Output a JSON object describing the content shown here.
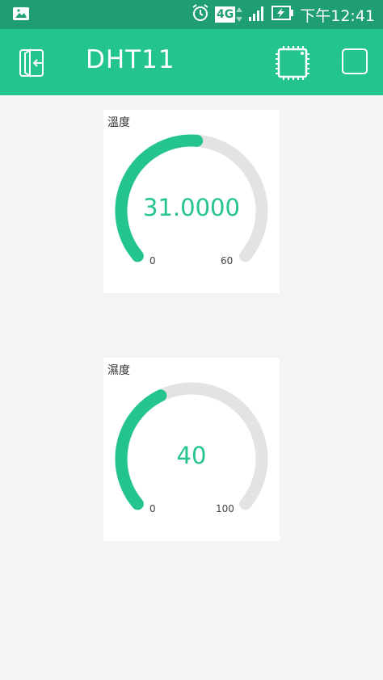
{
  "status": {
    "time": "下午12:41",
    "network": "4G"
  },
  "appbar": {
    "title": "DHT11"
  },
  "gauges": [
    {
      "label": "溫度",
      "value": "31.0000",
      "min": "0",
      "max": "60",
      "fraction": 0.5167
    },
    {
      "label": "濕度",
      "value": "40",
      "min": "0",
      "max": "100",
      "fraction": 0.4
    }
  ],
  "colors": {
    "accent": "#23c48e",
    "statusbar": "#1e9e72",
    "track": "#e3e3e3",
    "background": "#f4f4f4"
  }
}
